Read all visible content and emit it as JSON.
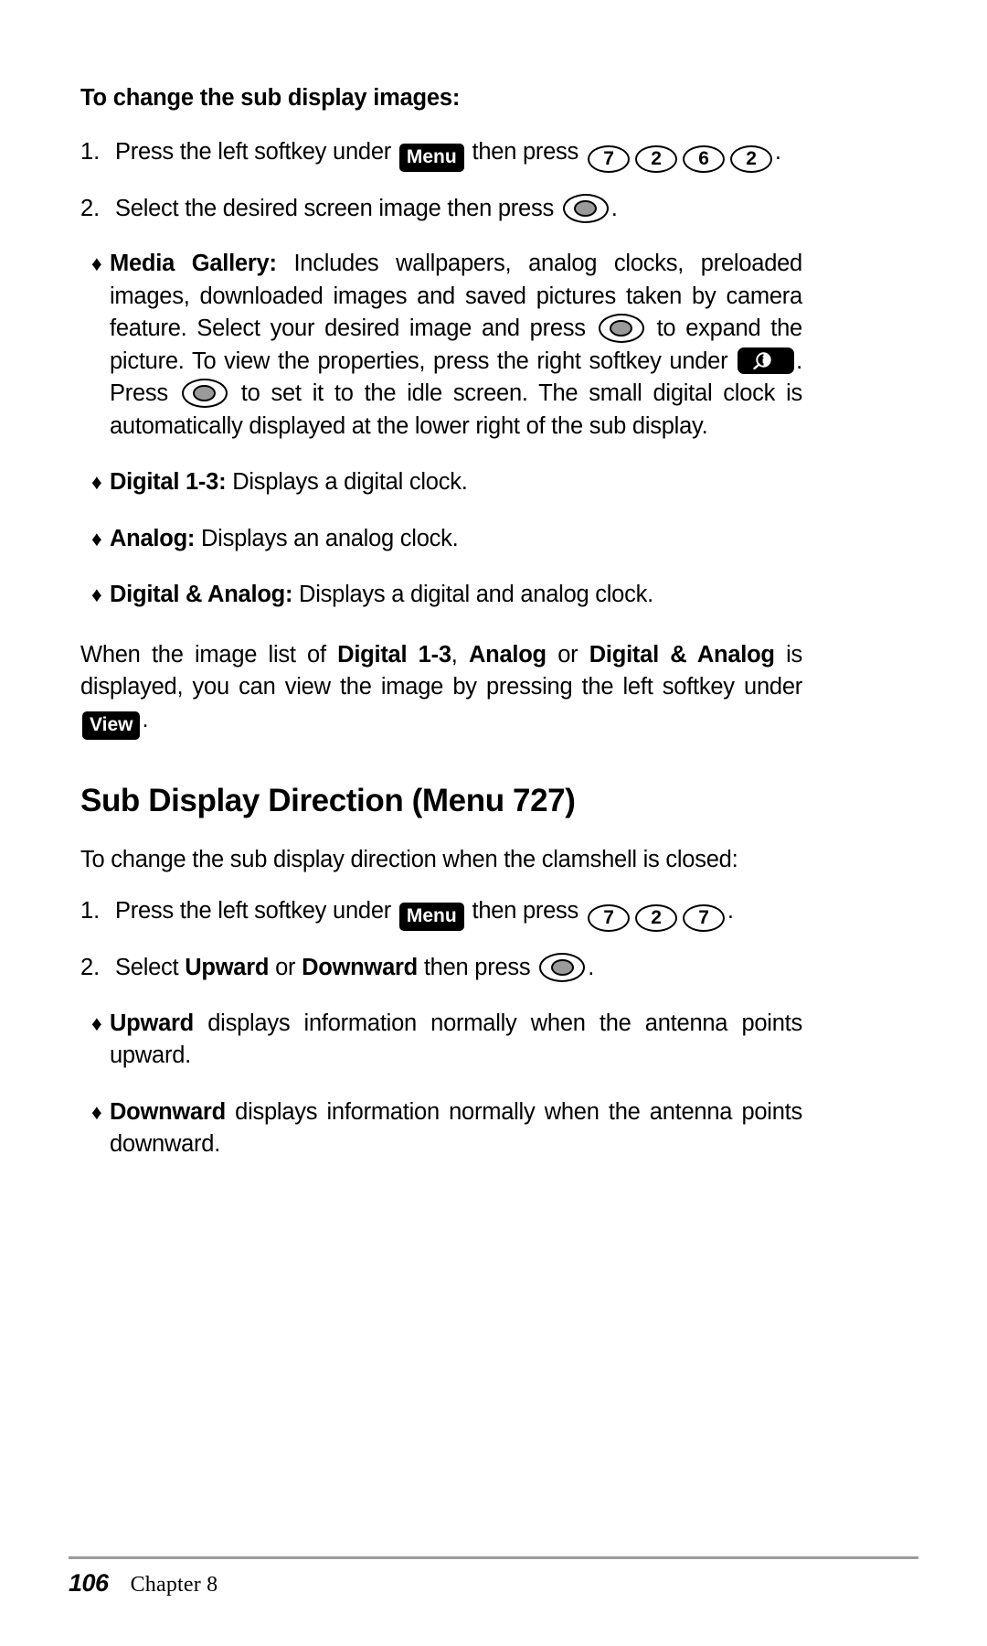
{
  "document": {
    "heading_1": "To change the sub display images:",
    "section_heading": "Sub Display Direction (Menu 727)"
  },
  "steps_1": [
    {
      "number": "1.",
      "text_before_badge": "Press the left softkey under ",
      "badge": "Menu",
      "text_after_badge": " then press ",
      "keys": [
        "7",
        "2",
        "6",
        "2"
      ],
      "text_end": "."
    },
    {
      "number": "2.",
      "text_before_key": "Select the desired screen image then press ",
      "ok_icon": "ok-key-icon",
      "text_end": "."
    }
  ],
  "bullets_1": [
    {
      "marker": "♦",
      "label": "Media Gallery:",
      "text_a": " Includes wallpapers, analog clocks, preloaded images, downloaded images and saved pictures taken by camera feature. Select your desired image and press ",
      "ok_icon_1": "ok-key-icon",
      "text_b": " to expand the picture. To view the properties, press the right softkey under ",
      "properties_icon": "properties-magnifier-icon",
      "text_c": ". Press ",
      "ok_icon_2": "ok-key-icon",
      "text_d": " to set it to the idle screen. The small digital clock is automatically displayed at the lower right of the sub display."
    },
    {
      "marker": "♦",
      "label": "Digital 1-3:",
      "text": " Displays a digital clock."
    },
    {
      "marker": "♦",
      "label": "Analog:",
      "text": " Displays an analog clock."
    },
    {
      "marker": "♦",
      "label": "Digital & Analog:",
      "text": " Displays a digital and analog clock."
    }
  ],
  "paragraph_1": {
    "part_1": "When the image list of ",
    "bold_1": "Digital 1-3",
    "part_2": ", ",
    "bold_2": "Analog",
    "part_3": " or ",
    "bold_3": "Digital & Analog",
    "part_4": " is displayed, you can view the image by pressing the left softkey under ",
    "badge": "View",
    "part_5": "."
  },
  "section_2": {
    "intro": "To change the sub display direction when the clamshell is closed:",
    "steps": [
      {
        "number": "1.",
        "text_before_badge": "Press the left softkey under ",
        "badge": "Menu",
        "text_after_badge": " then press ",
        "keys": [
          "7",
          "2",
          "7"
        ],
        "text_end": "."
      },
      {
        "number": "2.",
        "text_a": "Select ",
        "bold_1": "Upward",
        "text_b": " or ",
        "bold_2": "Downward",
        "text_c": " then press ",
        "ok_icon": "ok-key-icon",
        "text_end": "."
      }
    ],
    "bullets": [
      {
        "marker": "♦",
        "label": "Upward",
        "text": " displays information normally when the antenna points upward."
      },
      {
        "marker": "♦",
        "label": "Downward",
        "text": " displays information normally when the antenna points downward."
      }
    ]
  },
  "footer": {
    "page_number": "106",
    "chapter": "Chapter 8"
  },
  "colors": {
    "text": "#000000",
    "background": "#ffffff",
    "rule": "#9b9b9b",
    "ok_key_fill": "#9a9a9a"
  }
}
